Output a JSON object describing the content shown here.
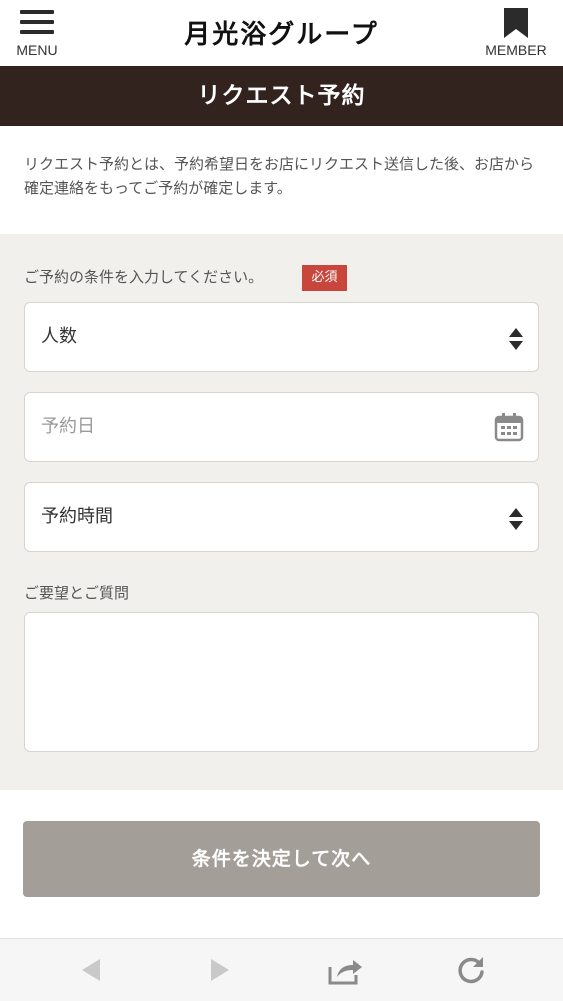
{
  "header": {
    "menu_label": "MENU",
    "menu_icon": "hamburger-icon",
    "logo_text": "月光浴グループ",
    "member_label": "MEMBER",
    "member_icon": "bookmark-icon"
  },
  "page_title": "リクエスト予約",
  "intro_text": "リクエスト予約とは、予約希望日をお店にリクエスト送信した後、お店から確定連絡をもってご予約が確定します。",
  "form": {
    "condition_label": "ご予約の条件を入力してください。",
    "required_badge": "必須",
    "people_select": {
      "value": "人数",
      "icon": "sort-arrows-icon"
    },
    "date_input": {
      "placeholder": "予約日",
      "icon": "calendar-icon"
    },
    "time_select": {
      "value": "予約時間",
      "icon": "sort-arrows-icon"
    },
    "requests_label": "ご要望とご質問",
    "requests_value": ""
  },
  "submit_label": "条件を決定して次へ",
  "browser_toolbar": {
    "icons": [
      "back-arrow-icon",
      "forward-arrow-icon",
      "share-icon",
      "reload-icon"
    ]
  },
  "colors": {
    "title_bar": "#32231f",
    "form_background": "#f2f0ec",
    "required_badge": "#c9463d",
    "submit_button": "#a39e98"
  }
}
